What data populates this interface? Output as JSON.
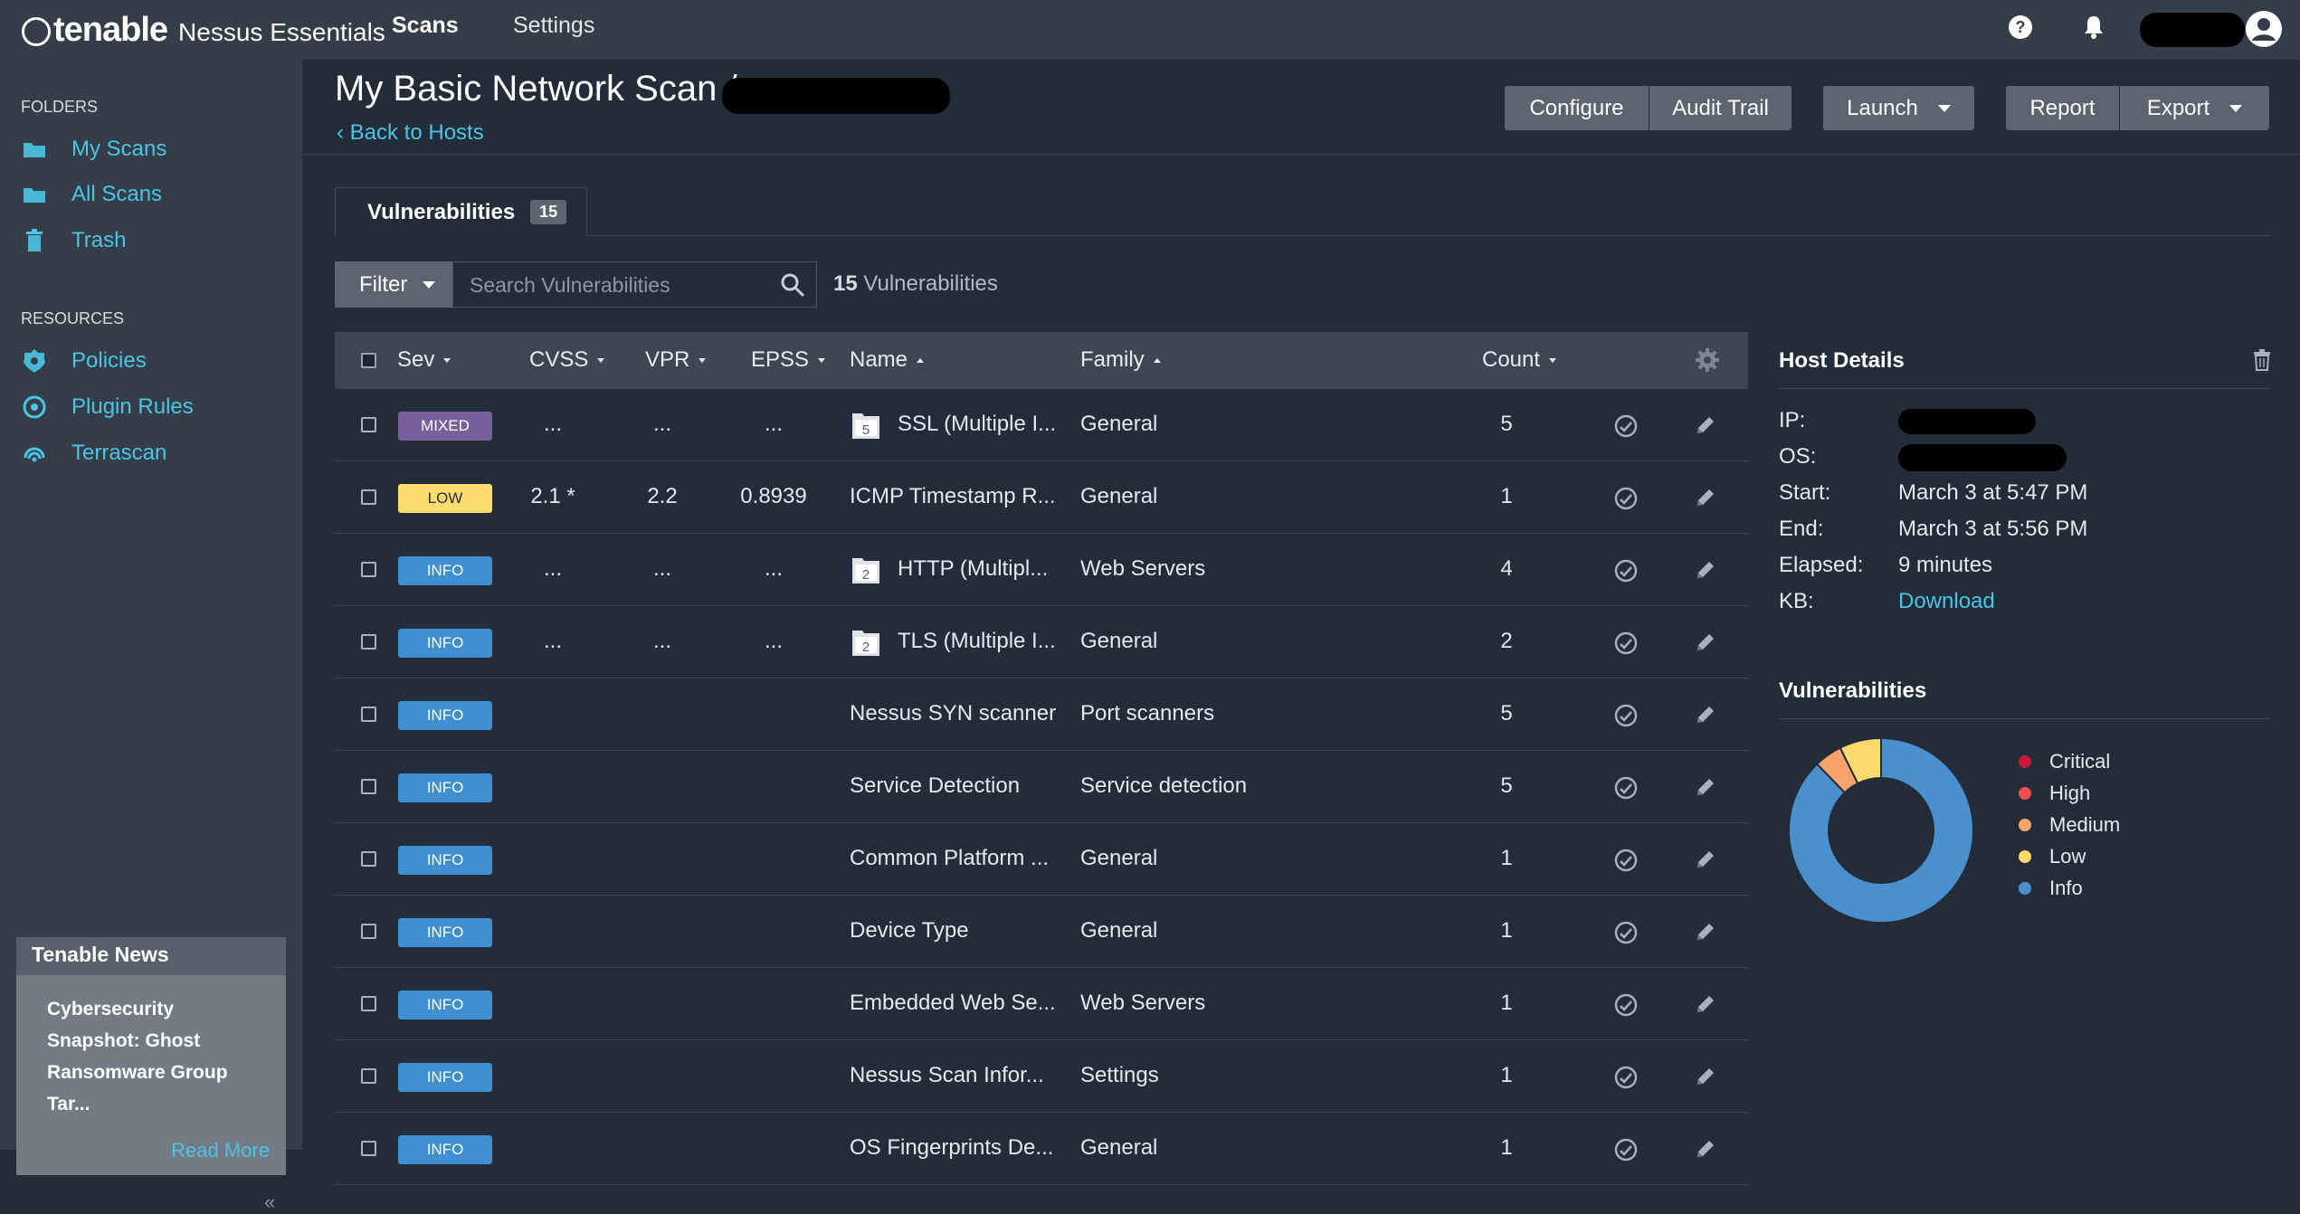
{
  "app": {
    "logo_word": "tenable",
    "product": "Nessus Essentials"
  },
  "topnav": {
    "scans": "Scans",
    "settings": "Settings"
  },
  "sidebar": {
    "folders_heading": "FOLDERS",
    "folders": [
      {
        "label": "My Scans",
        "icon": "folder-icon"
      },
      {
        "label": "All Scans",
        "icon": "folder-icon"
      },
      {
        "label": "Trash",
        "icon": "trash-icon"
      }
    ],
    "resources_heading": "RESOURCES",
    "resources": [
      {
        "label": "Policies",
        "icon": "shield-icon"
      },
      {
        "label": "Plugin Rules",
        "icon": "plugin-icon"
      },
      {
        "label": "Terrascan",
        "icon": "radar-icon"
      }
    ],
    "news": {
      "title": "Tenable News",
      "body": "Cybersecurity Snapshot: Ghost Ransomware Group Tar...",
      "read_more": "Read More"
    },
    "collapse": "«"
  },
  "page": {
    "title": "My Basic Network Scan /",
    "back": "‹ Back to Hosts"
  },
  "actions": {
    "configure": "Configure",
    "audit_trail": "Audit Trail",
    "launch": "Launch",
    "report": "Report",
    "export": "Export"
  },
  "tab": {
    "label": "Vulnerabilities",
    "badge": "15"
  },
  "filter": {
    "label": "Filter",
    "placeholder": "Search Vulnerabilities",
    "count_num": "15",
    "count_label": " Vulnerabilities"
  },
  "table": {
    "headers": {
      "sev": "Sev",
      "cvss": "CVSS",
      "vpr": "VPR",
      "epss": "EPSS",
      "name": "Name",
      "family": "Family",
      "count": "Count"
    },
    "rows": [
      {
        "sev": "MIXED",
        "sev_class": "mixed",
        "cvss": "...",
        "vpr": "...",
        "epss": "...",
        "folder": "5",
        "name": "SSL (Multiple I...",
        "family": "General",
        "count": "5"
      },
      {
        "sev": "LOW",
        "sev_class": "low",
        "cvss": "2.1 *",
        "vpr": "2.2",
        "epss": "0.8939",
        "folder": "",
        "name": "ICMP Timestamp R...",
        "family": "General",
        "count": "1"
      },
      {
        "sev": "INFO",
        "sev_class": "info",
        "cvss": "...",
        "vpr": "...",
        "epss": "...",
        "folder": "2",
        "name": "HTTP (Multipl...",
        "family": "Web Servers",
        "count": "4"
      },
      {
        "sev": "INFO",
        "sev_class": "info",
        "cvss": "...",
        "vpr": "...",
        "epss": "...",
        "folder": "2",
        "name": "TLS (Multiple I...",
        "family": "General",
        "count": "2"
      },
      {
        "sev": "INFO",
        "sev_class": "info",
        "cvss": "",
        "vpr": "",
        "epss": "",
        "folder": "",
        "name": "Nessus SYN scanner",
        "family": "Port scanners",
        "count": "5"
      },
      {
        "sev": "INFO",
        "sev_class": "info",
        "cvss": "",
        "vpr": "",
        "epss": "",
        "folder": "",
        "name": "Service Detection",
        "family": "Service detection",
        "count": "5"
      },
      {
        "sev": "INFO",
        "sev_class": "info",
        "cvss": "",
        "vpr": "",
        "epss": "",
        "folder": "",
        "name": "Common Platform ...",
        "family": "General",
        "count": "1"
      },
      {
        "sev": "INFO",
        "sev_class": "info",
        "cvss": "",
        "vpr": "",
        "epss": "",
        "folder": "",
        "name": "Device Type",
        "family": "General",
        "count": "1"
      },
      {
        "sev": "INFO",
        "sev_class": "info",
        "cvss": "",
        "vpr": "",
        "epss": "",
        "folder": "",
        "name": "Embedded Web Se...",
        "family": "Web Servers",
        "count": "1"
      },
      {
        "sev": "INFO",
        "sev_class": "info",
        "cvss": "",
        "vpr": "",
        "epss": "",
        "folder": "",
        "name": "Nessus Scan Infor...",
        "family": "Settings",
        "count": "1"
      },
      {
        "sev": "INFO",
        "sev_class": "info",
        "cvss": "",
        "vpr": "",
        "epss": "",
        "folder": "",
        "name": "OS Fingerprints De...",
        "family": "General",
        "count": "1"
      }
    ]
  },
  "host_details": {
    "title": "Host Details",
    "ip_label": "IP:",
    "os_label": "OS:",
    "start_label": "Start:",
    "start": "March 3 at 5:47 PM",
    "end_label": "End:",
    "end": "March 3 at 5:56 PM",
    "elapsed_label": "Elapsed:",
    "elapsed": "9 minutes",
    "kb_label": "KB:",
    "kb": "Download"
  },
  "vuln_chart": {
    "title": "Vulnerabilities",
    "legend": [
      {
        "label": "Critical",
        "color": "#c8163b"
      },
      {
        "label": "High",
        "color": "#ee4f50"
      },
      {
        "label": "Medium",
        "color": "#f7a36b"
      },
      {
        "label": "Low",
        "color": "#fdda6b"
      },
      {
        "label": "Info",
        "color": "#4a90cf"
      }
    ],
    "values": {
      "Critical": 0,
      "High": 0,
      "Medium": 0.5,
      "Low": 0.75,
      "Info": 9.0
    }
  }
}
